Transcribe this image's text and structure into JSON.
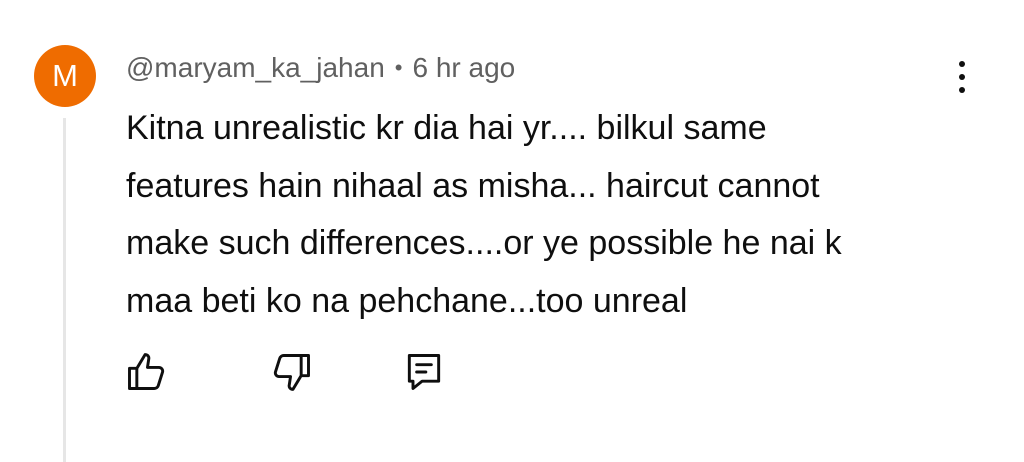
{
  "comment": {
    "avatar_initial": "M",
    "avatar_color": "#ef6c00",
    "author": "@maryam_ka_jahan",
    "separator": "•",
    "time": "6 hr ago",
    "text_lines": [
      "Kitna unrealistic kr dia hai yr.... bilkul same",
      "features hain nihaal as misha... haircut cannot",
      "make such differences....or ye possible he nai k",
      "maa beti ko na pehchane...too unreal"
    ]
  },
  "actions": {
    "like_icon": "thumbs-up-icon",
    "dislike_icon": "thumbs-down-icon",
    "reply_icon": "reply-comment-icon",
    "menu_icon": "more-vertical-icon"
  }
}
